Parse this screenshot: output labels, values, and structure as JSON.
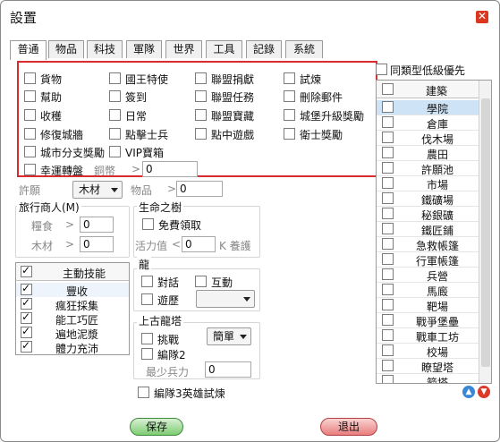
{
  "window": {
    "title": "設置"
  },
  "tabs": [
    "普通",
    "物品",
    "科技",
    "軍隊",
    "世界",
    "工具",
    "記錄",
    "系統"
  ],
  "tasks": [
    {
      "label": "貨物",
      "checked": false
    },
    {
      "label": "國王特使",
      "checked": false
    },
    {
      "label": "聯盟捐獻",
      "checked": false
    },
    {
      "label": "試煉",
      "checked": false
    },
    {
      "label": "幫助",
      "checked": false
    },
    {
      "label": "簽到",
      "checked": false
    },
    {
      "label": "聯盟任務",
      "checked": false
    },
    {
      "label": "刪除郵件",
      "checked": false
    },
    {
      "label": "收穫",
      "checked": false
    },
    {
      "label": "日常",
      "checked": false
    },
    {
      "label": "聯盟寶藏",
      "checked": false
    },
    {
      "label": "城堡升級獎勵",
      "checked": false
    },
    {
      "label": "修復城牆",
      "checked": false
    },
    {
      "label": "點擊士兵",
      "checked": false
    },
    {
      "label": "點中遊戲",
      "checked": false
    },
    {
      "label": "衛士獎勵",
      "checked": false
    },
    {
      "label": "城市分支獎勵",
      "checked": false
    },
    {
      "label": "VIP寶箱",
      "checked": false
    }
  ],
  "lucky": {
    "label": "幸運轉盤",
    "checked": false,
    "coin_label": "銅幣",
    "gt": ">",
    "value": "0"
  },
  "wish": {
    "label": "許願",
    "select": "木材",
    "item_label": "物品",
    "gt": ">",
    "value": "0"
  },
  "merchant": {
    "title": "旅行商人(M)",
    "food_label": "糧食",
    "food_gt": ">",
    "food_value": "0",
    "wood_label": "木材",
    "wood_gt": ">",
    "wood_value": "0"
  },
  "tree": {
    "title": "生命之樹",
    "free_label": "免費領取",
    "free_checked": false,
    "vitality_label": "活力值",
    "lt": "<",
    "vitality_value": "0",
    "unit": "K 養護"
  },
  "skills": {
    "header": "主動技能",
    "items": [
      {
        "label": "豐收",
        "checked": true
      },
      {
        "label": "瘋狂採集",
        "checked": true
      },
      {
        "label": "能工巧匠",
        "checked": true
      },
      {
        "label": "遍地泥漿",
        "checked": true
      },
      {
        "label": "體力充沛",
        "checked": true
      }
    ]
  },
  "dragon": {
    "title": "龍",
    "talk_label": "對話",
    "talk_checked": false,
    "interact_label": "互動",
    "interact_checked": false,
    "travel_label": "遊歷",
    "travel_checked": false,
    "travel_select": ""
  },
  "tower": {
    "title": "上古龍塔",
    "challenge_label": "挑戰",
    "challenge_checked": false,
    "difficulty": "簡單",
    "team2_label": "編隊2",
    "team2_checked": false,
    "min_power_label": "最少兵力",
    "min_power_value": "0"
  },
  "hero_trial": {
    "label": "編隊3英雄試煉",
    "checked": false
  },
  "right_panel": {
    "low_level_label": "同類型低級優先",
    "low_level_checked": false,
    "column_header": "建築",
    "buildings": [
      "學院",
      "倉庫",
      "伐木場",
      "農田",
      "許願池",
      "市場",
      "鐵礦場",
      "秘銀礦",
      "鐵匠鋪",
      "急救帳篷",
      "行軍帳篷",
      "兵營",
      "馬廄",
      "靶場",
      "戰爭堡壘",
      "戰車工坊",
      "校場",
      "瞭望塔",
      "箭塔"
    ]
  },
  "buttons": {
    "save": "保存",
    "exit": "退出"
  },
  "colors": {
    "highlight_border": "#d92d2d",
    "selected_row": "#cfe3f7",
    "close_bg": "#d9371f"
  }
}
